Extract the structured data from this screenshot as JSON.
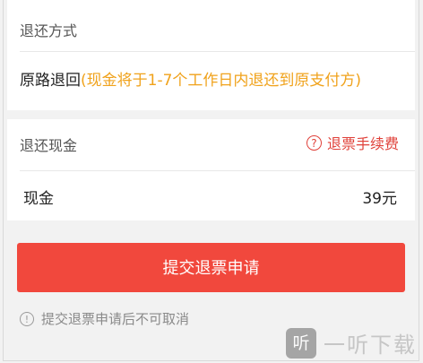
{
  "refund_method": {
    "title": "退还方式",
    "method": "原路退回",
    "note": "(现金将于1-7个工作日内退还到原支付方)"
  },
  "refund_cash": {
    "title": "退还现金",
    "fee_link": "退票手续费",
    "cash_label": "现金",
    "cash_value": "39元"
  },
  "submit_label": "提交退票申请",
  "warning": "提交退票申请后不可取消",
  "watermark": {
    "badge": "听",
    "text": "一听下载"
  },
  "colors": {
    "accent_red": "#f1483d",
    "note_orange": "#f0a21b"
  },
  "icons": [
    "question-circle-icon",
    "exclamation-circle-icon"
  ]
}
